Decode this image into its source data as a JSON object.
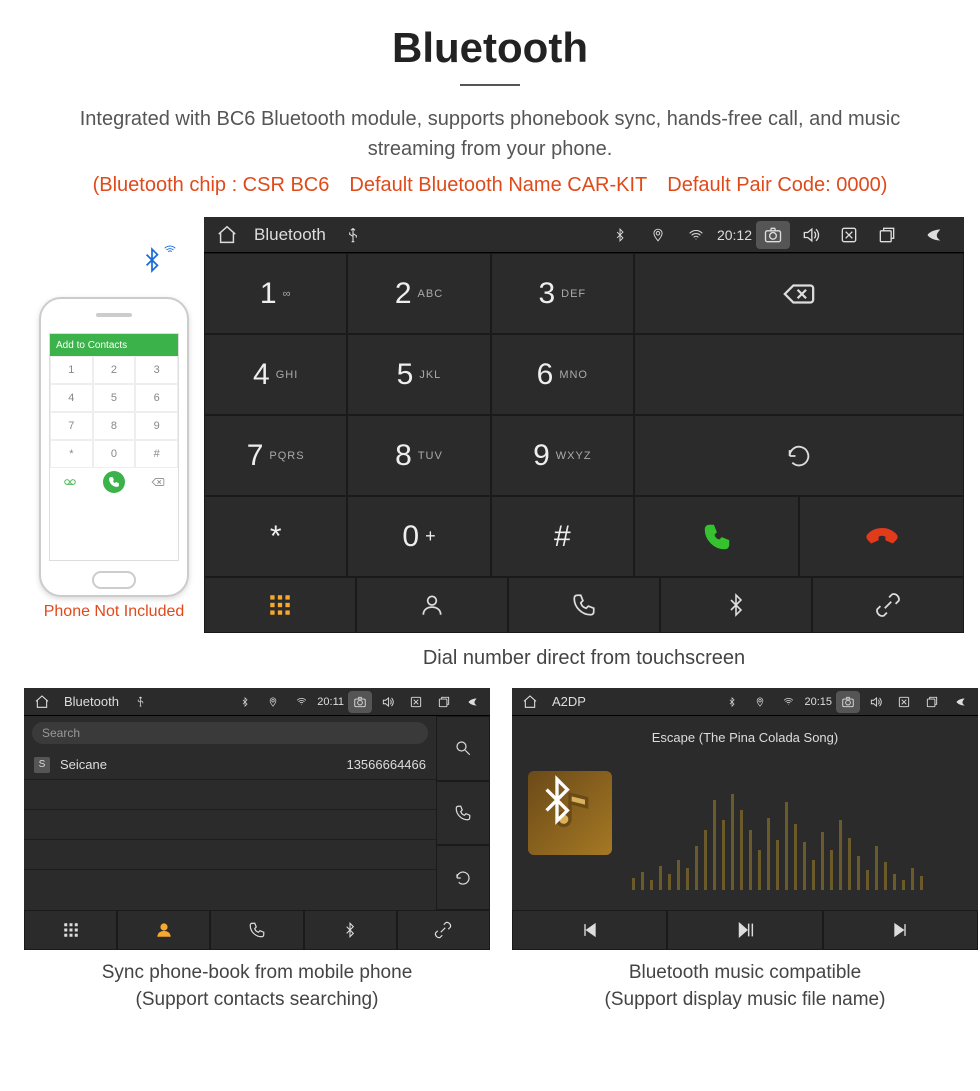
{
  "page": {
    "title": "Bluetooth",
    "lead": "Integrated with BC6 Bluetooth module, supports phonebook sync, hands-free call, and music streaming from your phone.",
    "spec": "(Bluetooth chip : CSR BC6 Default Bluetooth Name CAR-KIT Default Pair Code: 0000)",
    "phone_not_included": "Phone Not Included",
    "caption_main": "Dial number direct from touchscreen",
    "caption_contacts_l1": "Sync phone-book from mobile phone",
    "caption_contacts_l2": "(Support contacts searching)",
    "caption_a2dp_l1": "Bluetooth music compatible",
    "caption_a2dp_l2": "(Support display music file name)"
  },
  "phone_mock": {
    "add_contacts": "Add to Contacts",
    "keys": [
      "1",
      "2",
      "3",
      "4",
      "5",
      "6",
      "7",
      "8",
      "9",
      "*",
      "0",
      "#"
    ]
  },
  "hu_main": {
    "title": "Bluetooth",
    "clock": "20:12",
    "keypad": [
      {
        "num": "1",
        "sub": "∞"
      },
      {
        "num": "2",
        "sub": "ABC"
      },
      {
        "num": "3",
        "sub": "DEF"
      },
      {
        "num": "4",
        "sub": "GHI"
      },
      {
        "num": "5",
        "sub": "JKL"
      },
      {
        "num": "6",
        "sub": "MNO"
      },
      {
        "num": "7",
        "sub": "PQRS"
      },
      {
        "num": "8",
        "sub": "TUV"
      },
      {
        "num": "9",
        "sub": "WXYZ"
      },
      {
        "num": "*",
        "sub": ""
      },
      {
        "num": "0",
        "sub": "+",
        "plus": true
      },
      {
        "num": "#",
        "sub": ""
      }
    ],
    "tabs": [
      "dialpad",
      "contacts",
      "calls",
      "bluetooth",
      "link"
    ],
    "active_tab": 0
  },
  "hu_contacts": {
    "title": "Bluetooth",
    "clock": "20:11",
    "search_placeholder": "Search",
    "rows": [
      {
        "badge": "S",
        "name": "Seicane",
        "number": "13566664466"
      }
    ],
    "active_tab": 1
  },
  "hu_a2dp": {
    "title": "A2DP",
    "clock": "20:15",
    "song": "Escape (The Pina Colada Song)"
  },
  "icons": {
    "home": "home-icon",
    "usb": "usb-icon",
    "bt": "bluetooth-icon",
    "gps": "location-icon",
    "wifi": "wifi-icon",
    "camera": "camera-icon",
    "volume": "volume-icon",
    "close": "close-box-icon",
    "recent": "recent-apps-icon",
    "back": "back-icon",
    "backspace": "backspace-icon",
    "refresh": "refresh-icon",
    "call": "call-icon",
    "hangup": "hangup-icon",
    "grid": "grid-icon",
    "person": "person-icon",
    "phone": "phone-outline-icon",
    "link": "link-icon",
    "search": "search-icon",
    "prev": "skip-previous-icon",
    "play": "play-pause-icon",
    "next": "skip-next-icon",
    "note": "music-note-icon"
  },
  "colors": {
    "accent": "#e04a1a",
    "call_green": "#36c12f",
    "hangup_red": "#e23b1c",
    "gold": "#f7a82e",
    "panel": "#2b2b2b"
  }
}
